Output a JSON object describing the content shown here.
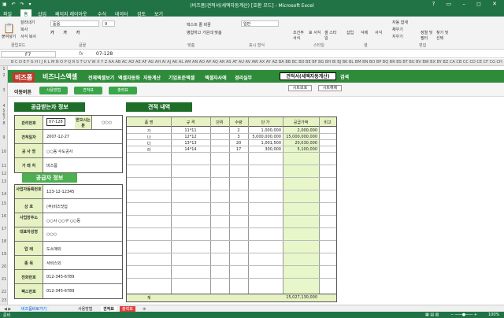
{
  "window": {
    "title": "(비즈폼)견적서(세액자동계산) [호환 모드] - Microsoft Excel"
  },
  "menu": [
    "파일",
    "홈",
    "삽입",
    "페이지 레이아웃",
    "수식",
    "데이터",
    "검토",
    "보기"
  ],
  "ribbon": {
    "paste": "붙여넣기",
    "cut": "잘라내기",
    "copy": "복사",
    "format_painter": "서식 복사",
    "font": "돋움",
    "size": "9",
    "wrap": "텍스트 줄 바꿈",
    "merge": "병합하고 가운데 맞춤",
    "number_format": "일반",
    "conditional": "조건부 서식",
    "table_fmt": "표 서식",
    "cell_style": "셀 스타일",
    "insert": "삽입",
    "delete": "삭제",
    "format": "서식",
    "autosum": "자동 합계",
    "fill": "채우기",
    "clear": "지우기",
    "sort": "정렬 및 필터",
    "find": "찾기 및 선택",
    "groups": [
      "클립보드",
      "글꼴",
      "맞춤",
      "표시 형식",
      "스타일",
      "셀",
      "편집"
    ]
  },
  "formula": {
    "namebox": "F7",
    "value": "07-128"
  },
  "columns": "B C D E F G H I J K L M N O P Q R S T U V W X Y Z AA AB AC AD AE AF AG AH AI AJ AK AL AM AN AO AP AQ AR AS AT AU AV AW AX AY AZ BA BB BC BD BE BF BG BH BI BJ BK BL BM BN BO BP BQ BR BS BT BU BV BW BX BY BZ CA CB CC CD CE CF CG CH",
  "rows": [
    "1",
    "2",
    "3",
    "4",
    "5",
    "6",
    "7",
    "8",
    "9",
    "10",
    "11",
    "12",
    "13",
    "14",
    "15",
    "16",
    "17",
    "18",
    "19",
    "20",
    "21",
    "22",
    "23",
    "24",
    "25",
    "26",
    "27",
    "28",
    "29",
    "30",
    "31",
    "32",
    "33"
  ],
  "nav": {
    "logo": "비즈폼",
    "logo2": "비즈니스엑셀",
    "items": [
      "전체엑셀보기",
      "엑셀자동화",
      "자동계산",
      "기업표준엑셀",
      "엑셀자사에",
      "경리실무"
    ],
    "current": "견적서(세액자동계산)",
    "search": "검색"
  },
  "sub": {
    "label": "이동버튼",
    "buttons": [
      "사용방법",
      "견적표",
      "출력표"
    ],
    "print1": "시트보호",
    "print2": "시트해제"
  },
  "receiver": {
    "title": "공급받는자 정보",
    "rows": [
      {
        "k": "관리번호",
        "v": "07-128",
        "k2": "받으시는 분",
        "v2": "○○○"
      },
      {
        "k": "견적일자",
        "v": "2007-12-27"
      },
      {
        "k": "공 사 명",
        "v": "○○동 수도공사"
      },
      {
        "k": "거 래 처",
        "v": "비즈폼"
      }
    ]
  },
  "supplier": {
    "title": "공급자 정보",
    "rows": [
      {
        "k": "사업자등록번호",
        "v": "123-12-12345"
      },
      {
        "k": "상 호",
        "v": "(주)비즈맛집"
      },
      {
        "k": "사업장주소",
        "v": "○○시 ○○구 ○○동"
      },
      {
        "k": "대표자성명",
        "v": "○○○"
      },
      {
        "k": "업 태",
        "v": "도소매외"
      },
      {
        "k": "종 목",
        "v": "서비스외"
      },
      {
        "k": "전화번호",
        "v": "012-345-6789"
      },
      {
        "k": "팩스번호",
        "v": "012-345-6789"
      }
    ]
  },
  "detail": {
    "title": "견적 내역",
    "headers": [
      "품 명",
      "규 격",
      "단위",
      "수량",
      "단 가",
      "공급가액",
      "비고"
    ],
    "items": [
      {
        "name": "가",
        "spec": "11*11",
        "qty": "2",
        "price": "1,000,000",
        "amount": "2,000,000"
      },
      {
        "name": "나",
        "spec": "12*12",
        "qty": "3",
        "price": "5,000,000,000",
        "amount": "15,000,000,000"
      },
      {
        "name": "다",
        "spec": "13*13",
        "qty": "20",
        "price": "1,001,500",
        "amount": "20,030,000"
      },
      {
        "name": "라",
        "spec": "14*14",
        "qty": "17",
        "price": "300,000",
        "amount": "5,100,000"
      }
    ],
    "total_label": "계",
    "total": "15,027,130,000"
  },
  "tabs": [
    "비즈폼바로가기",
    "사용방법",
    "견적표",
    "출력표"
  ],
  "status": {
    "ready": "준비",
    "zoom": "100%"
  }
}
